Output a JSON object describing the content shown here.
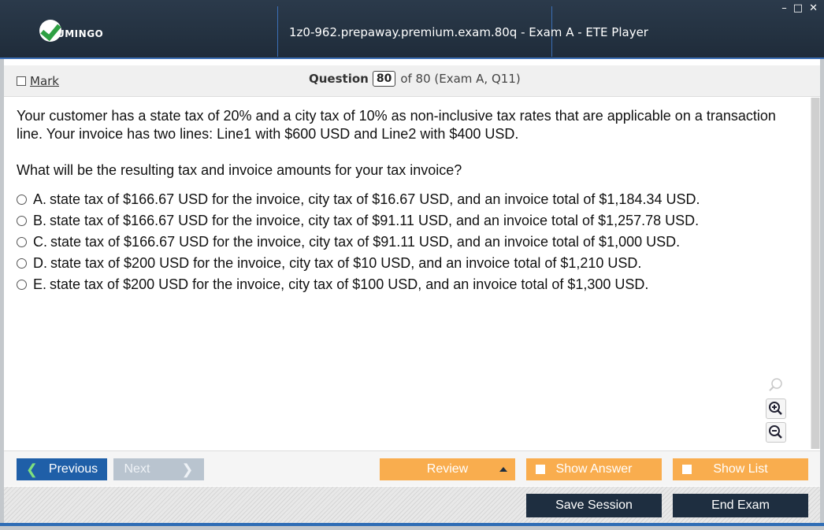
{
  "titlebar": {
    "logo_text": "UMINGO",
    "title": "1z0-962.prepaway.premium.exam.80q - Exam A - ETE Player",
    "minimize": "–",
    "maximize": "□",
    "close": "✕"
  },
  "header": {
    "mark_label": "Mark",
    "question_label": "Question",
    "question_number": "80",
    "question_suffix": "of 80 (Exam A, Q11)"
  },
  "question": {
    "text": "Your customer has a state tax of 20% and a city tax of 10% as non-inclusive tax rates that are applicable on a transaction line. Your invoice has two lines: Line1 with $600 USD and Line2 with $400 USD.",
    "prompt": "What will be the resulting tax and invoice amounts for your tax invoice?",
    "options": [
      {
        "letter": "A.",
        "text": "state tax of $166.67 USD for the invoice, city tax of $16.67 USD, and an invoice total of $1,184.34 USD."
      },
      {
        "letter": "B.",
        "text": "state tax of $166.67 USD for the invoice, city tax of $91.11 USD, and an invoice total of $1,257.78 USD."
      },
      {
        "letter": "C.",
        "text": "state tax of $166.67 USD for the invoice, city tax of $91.11 USD, and an invoice total of $1,000 USD."
      },
      {
        "letter": "D.",
        "text": "state tax of $200 USD for the invoice, city tax of $10 USD, and an invoice total of $1,210 USD."
      },
      {
        "letter": "E.",
        "text": "state tax of $200 USD for the invoice, city tax of $100 USD, and an invoice total of $1,300 USD."
      }
    ]
  },
  "nav": {
    "previous_label": "Previous",
    "next_label": "Next",
    "review_label": "Review",
    "show_answer_label": "Show Answer",
    "show_list_label": "Show List",
    "save_session_label": "Save Session",
    "end_exam_label": "End Exam"
  },
  "icons": {
    "search": "search-icon",
    "zoom_in": "zoom-in-icon",
    "zoom_out": "zoom-out-icon"
  },
  "colors": {
    "titlebar": "#1f2c3a",
    "accent_blue": "#1f5fa8",
    "orange": "#f9ad4e",
    "dark_button": "#1e2e40"
  }
}
